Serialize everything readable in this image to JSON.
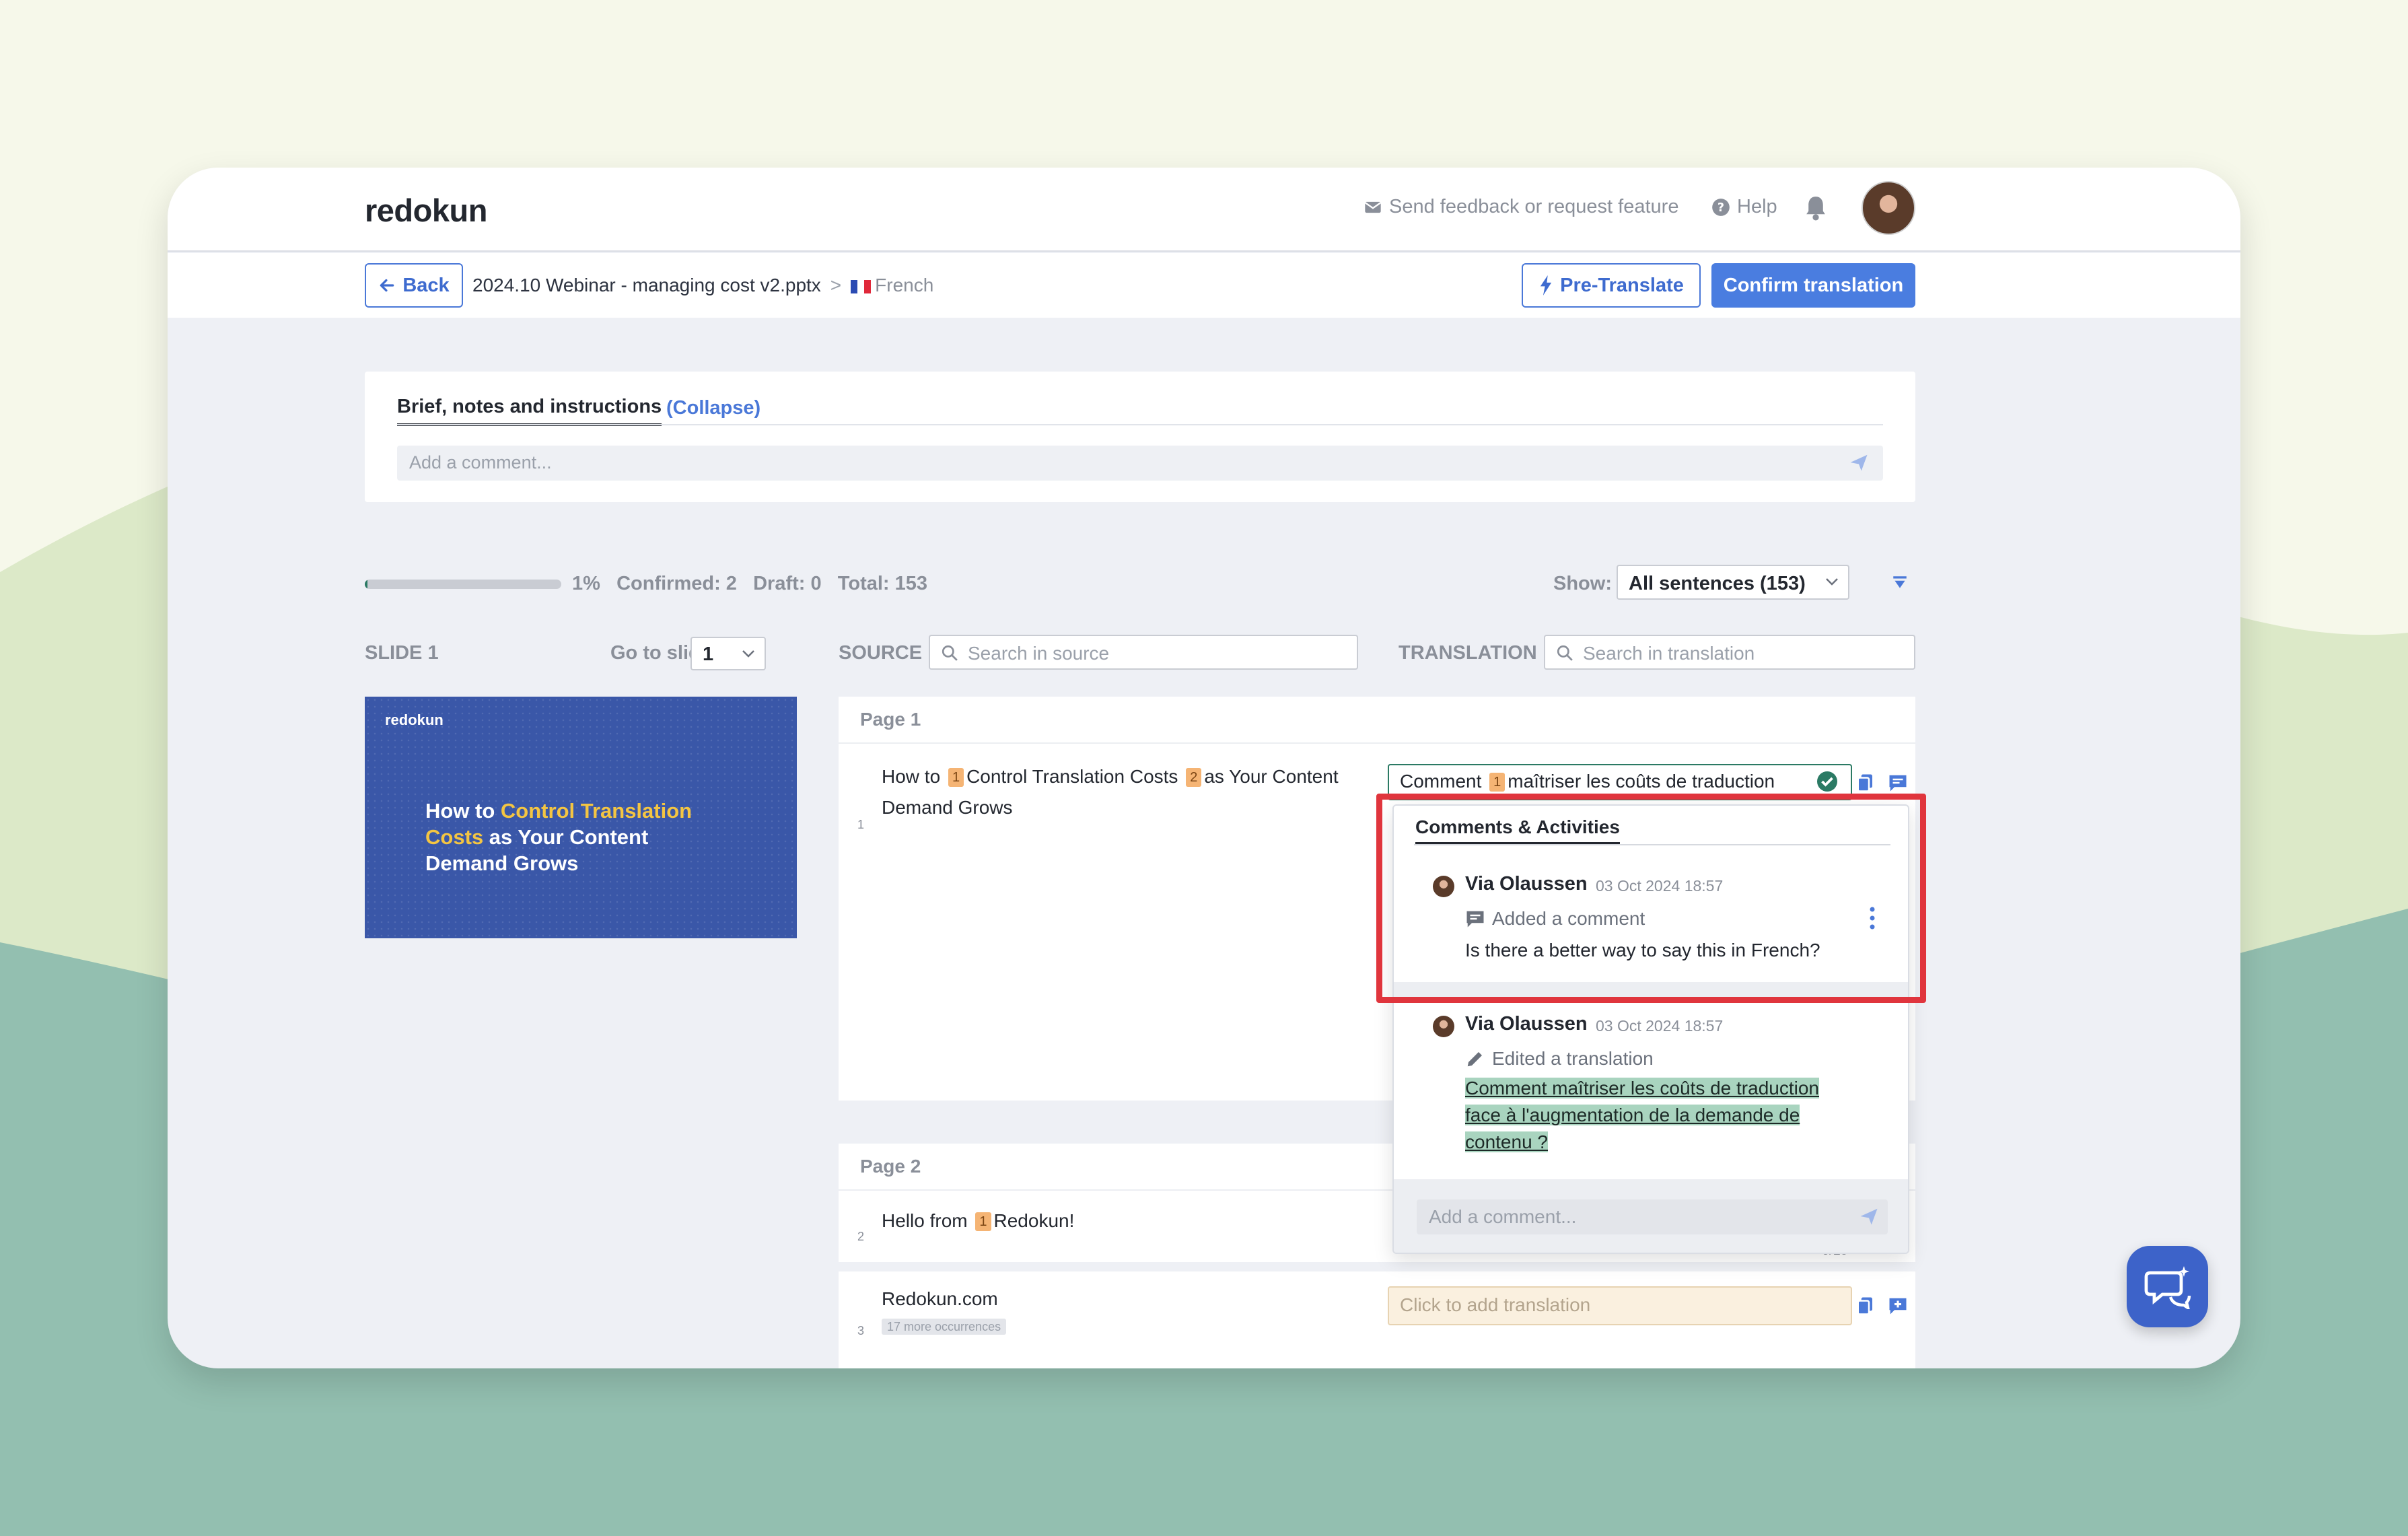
{
  "app": {
    "logo": "redokun"
  },
  "topbar": {
    "feedback_label": "Send feedback or request feature",
    "help_label": "Help"
  },
  "subbar": {
    "back_label": "Back",
    "file_name": "2024.10 Webinar - managing cost v2.pptx",
    "separator": ">",
    "language": "French",
    "pretranslate_label": "Pre-Translate",
    "confirm_label": "Confirm translation"
  },
  "brief": {
    "tab_label": "Brief, notes and instructions",
    "collapse_label": "(Collapse)",
    "comment_placeholder": "Add a comment..."
  },
  "progress": {
    "percent_value": 0.01,
    "percent_label": "1%",
    "confirmed_label": "Confirmed: 2",
    "draft_label": "Draft: 0",
    "total_label": "Total: 153"
  },
  "filter": {
    "show_label": "Show:",
    "show_value": "All sentences (153)"
  },
  "columns": {
    "slide_label": "SLIDE 1",
    "goto_label": "Go to slide:",
    "goto_value": "1",
    "source_label": "SOURCE",
    "source_search_placeholder": "Search in source",
    "translation_label": "TRANSLATION",
    "translation_search_placeholder": "Search in translation"
  },
  "slide_preview": {
    "logo": "redokun",
    "title_part1": "How to ",
    "title_highlight": "Control Translation Costs",
    "title_part2": " as Your Content Demand Grows"
  },
  "segments": {
    "page1_label": "Page 1",
    "seg1": {
      "num": "1",
      "text_a": "How to",
      "tag1": "1",
      "text_b": "Control Translation Costs",
      "tag2": "2",
      "text_c": "as Your Content Demand Grows",
      "translation_a": "Comment",
      "translation_tag": "1",
      "translation_b": "maîtriser les coûts de traduction"
    },
    "page2_label": "Page 2",
    "seg2": {
      "num": "2",
      "text_a": "Hello from",
      "tag1": "1",
      "text_b": "Redokun!",
      "counter": "0/19"
    },
    "seg3": {
      "num": "3",
      "text": "Redokun.com",
      "occurrences": "17 more occurrences",
      "translation_placeholder": "Click to add translation"
    }
  },
  "activity_popover": {
    "title": "Comments & Activities",
    "items": [
      {
        "user": "Via Olaussen",
        "date": "03 Oct 2024 18:57",
        "kind": "Added a comment",
        "body": "Is there a better way to say this in French?"
      },
      {
        "user": "Via Olaussen",
        "date": "03 Oct 2024 18:57",
        "kind": "Edited a translation",
        "body": "Comment maîtriser les coûts de traduction face à l'augmentation de la demande de contenu ?"
      }
    ],
    "comment_placeholder": "Add a comment..."
  },
  "colors": {
    "accent": "#4a7de0",
    "confirmed_green": "#2b7a64",
    "highlight_red": "#e0353d",
    "tag_orange": "#f5b474"
  }
}
